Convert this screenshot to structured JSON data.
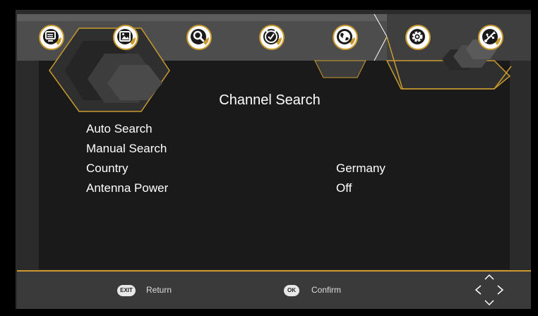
{
  "colors": {
    "accent": "#c99a2e",
    "tab_bar": "#555555",
    "panel": "#1a1a1a",
    "frame": "#2b2b2b",
    "text": "#ffffff"
  },
  "tabs": [
    {
      "name": "picture-menu",
      "icon": "monitor-icon"
    },
    {
      "name": "image",
      "icon": "image-icon"
    },
    {
      "name": "search",
      "icon": "search-icon"
    },
    {
      "name": "timer",
      "icon": "clock-icon"
    },
    {
      "name": "language",
      "icon": "globe-icon"
    },
    {
      "name": "setup",
      "icon": "gear-icon",
      "active": true
    },
    {
      "name": "usb-media",
      "icon": "usb-icon"
    }
  ],
  "page": {
    "title": "Channel Search"
  },
  "menu": {
    "items": [
      {
        "label": "Auto Search",
        "value": ""
      },
      {
        "label": "Manual Search",
        "value": ""
      },
      {
        "label": "Country",
        "value": "Germany"
      },
      {
        "label": "Antenna Power",
        "value": "Off"
      }
    ]
  },
  "footer": {
    "exit_key": "EXIT",
    "return_label": "Return",
    "ok_key": "OK",
    "confirm_label": "Confirm",
    "nav_icon": "navigation-arrows-icon"
  }
}
